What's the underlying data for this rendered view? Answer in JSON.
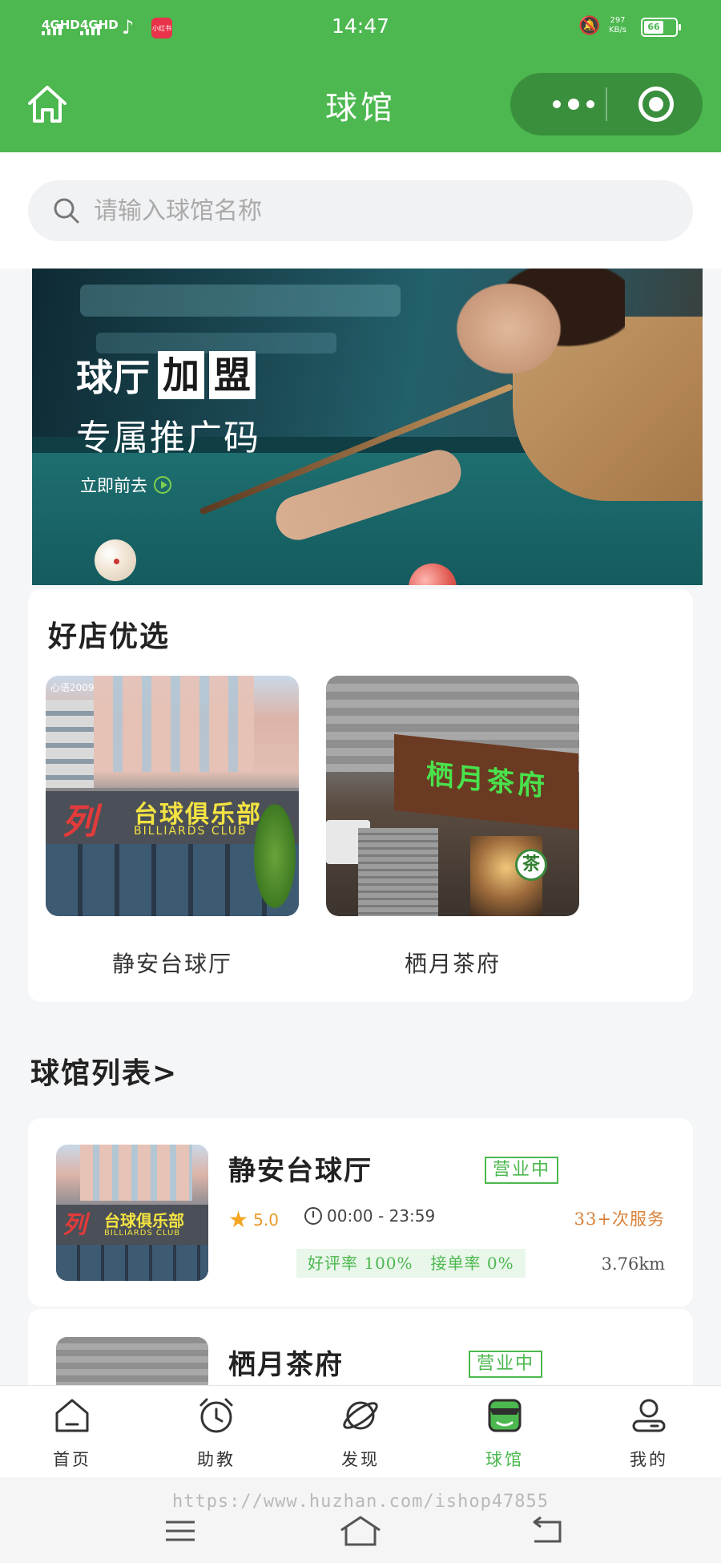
{
  "status_bar": {
    "network1": "4GHD",
    "network2": "4GHD",
    "app_badge": "小红书",
    "time": "14:47",
    "speed_value": "297",
    "speed_unit": "KB/s",
    "battery": "66"
  },
  "nav": {
    "title": "球馆",
    "icons": [
      "home-icon",
      "more-dots-icon",
      "close-target-icon"
    ]
  },
  "search": {
    "placeholder": "请输入球馆名称"
  },
  "banner": {
    "line1_prefix": "球厅",
    "line1_box1": "加",
    "line1_box2": "盟",
    "line2": "专属推广码",
    "cta": "立即前去"
  },
  "featured": {
    "title": "好店优选",
    "shops": [
      {
        "name": "静安台球厅",
        "sign_cn": "台球俱乐部",
        "sign_en": "BILLIARDS CLUB",
        "sign_red": "列",
        "watermark": "心语2009"
      },
      {
        "name": "栖月茶府",
        "sign_cn": "栖月茶府",
        "badge": "茶"
      }
    ]
  },
  "list": {
    "title": "球馆列表>",
    "venues": [
      {
        "name": "静安台球厅",
        "status": "营业中",
        "rating": "5.0",
        "hours": "00:00 - 23:59",
        "services": "33+次服务",
        "good_rate": "好评率 100%",
        "accept_rate": "接单率 0%",
        "distance": "3.76km"
      },
      {
        "name": "栖月茶府",
        "status": "营业中"
      }
    ]
  },
  "tabbar": {
    "items": [
      {
        "label": "首页",
        "icon": "home-icon"
      },
      {
        "label": "助教",
        "icon": "alarm-clock-icon"
      },
      {
        "label": "发现",
        "icon": "planet-icon"
      },
      {
        "label": "球馆",
        "icon": "store-icon"
      },
      {
        "label": "我的",
        "icon": "user-icon"
      }
    ],
    "active_index": 3
  },
  "system_nav": {
    "watermark": "https://www.huzhan.com/ishop47855",
    "icons": [
      "menu-icon",
      "home-outline-icon",
      "back-icon"
    ]
  },
  "colors": {
    "brand_green": "#4cb84f",
    "capsule_green": "#3a8f3d",
    "orange": "#d9823a",
    "star": "#f5a623"
  }
}
